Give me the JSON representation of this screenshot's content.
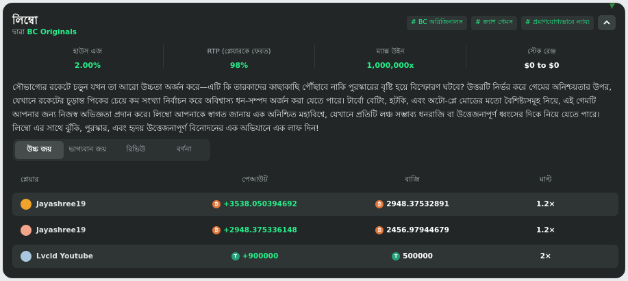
{
  "header": {
    "title": "লিম্বো",
    "by_prefix": "দ্বারা",
    "provider": "BC Originals",
    "tags": [
      "# BC অরিজিনালস",
      "# ক্র্যাশ গেমস",
      "# প্রমাণযোগ্যভাবে ন্যায্য"
    ],
    "collapse_icon": "chevron-up-icon"
  },
  "stats": [
    {
      "label": "হাউস এজ",
      "value": "2.00%"
    },
    {
      "label": "RTP (প্লেয়ারকে ফেরত)",
      "value": "98%"
    },
    {
      "label": "ম্যাক্স উইন",
      "value": "1,000,000x"
    },
    {
      "label": "স্টেক রেঞ্জ",
      "value": "$0 to $0"
    }
  ],
  "description": "সৌভাগ্যের রকেটে চড়ুন যখন তা আরো উচ্চতা অর্জন করে—এটি কি তারকাদের কাছাকাছি পৌঁছাবে নাকি পুরস্কারের বৃষ্টি হয়ে বিস্ফোরণ ঘটবে? উত্তরটি নির্ভর করে গেমের অনিশ্চয়তার উপর, যেখানে রকেটের চূড়ান্ত পিকের চেয়ে কম সংখ্যা নির্বাচন করে অবিশ্বাস্য ধন-সম্পদ অর্জন করা যেতে পারে। টার্বো বেটিং, হটকি, এবং অটো-প্লে মোডের মতো বৈশিষ্ট্যসমূহ নিয়ে, এই গেমটি আপনার জন্য নিজস্ব অভিজ্ঞতা প্রদান করে। লিম্বো আপনাকে স্বাগত জানায় এক অনিশ্চিত মহাবিশ্বে, যেখানে প্রতিটি লঞ্চ সম্ভাব্য ধনরাজি বা উত্তেজনাপূর্ণ ধ্বংসের দিকে নিয়ে যেতে পারে। লিম্বো এর সাথে ঝুঁকি, পুরস্কার, এবং হৃদয় উত্তেজনাপূর্ণ বিনোদনের এক অভিযানে এক লাফ দিন!",
  "tabs": [
    "উচ্চ জয়",
    "ভাগ্যবান জয়",
    "রিভিউ",
    "বর্ণনা"
  ],
  "table": {
    "headers": [
      "প্লেয়ার",
      "পেআউট",
      "বাজি",
      "মাল্ট"
    ],
    "rows": [
      {
        "player": "Jayashree19",
        "payout": "+3538.050394692",
        "bet": "2948.37532891",
        "mult": "1.2×",
        "coin": "orange",
        "avatar_color": "#f0a22a"
      },
      {
        "player": "Jayashree19",
        "payout": "+2948.375336148",
        "bet": "2456.97944679",
        "mult": "1.2×",
        "coin": "orange",
        "avatar_color": "#f3a58a"
      },
      {
        "player": "Lvcid Youtube",
        "payout": "+900000",
        "bet": "500000",
        "mult": "2×",
        "coin": "green",
        "avatar_color": "#a9c8e0"
      }
    ]
  },
  "colors": {
    "accent": "#24ee89",
    "panel": "#232626",
    "row": "#2f3434"
  }
}
